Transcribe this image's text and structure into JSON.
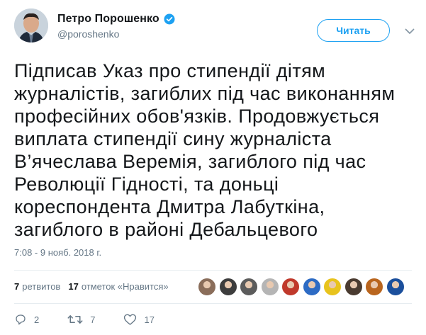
{
  "author": {
    "name": "Петро Порошенко",
    "handle": "@poroshenko"
  },
  "follow_button": {
    "label": "Читать"
  },
  "tweet": {
    "text": "Підписав Указ про стипендії дітям\nжурналістів, загиблих під час виконанням\nпрофесійних обов'язків. Продовжується\nвиплата стипендії сину журналіста\nВ’ячеслава Веремія, загиблого під час\nРеволюції Гідності, та доньці\nкореспондента Дмитра Лабуткіна,\nзагиблого в районі Дебальцевого",
    "timestamp": "7:08 - 9 нояб. 2018 г."
  },
  "stats": {
    "retweets_count": "7",
    "retweets_label": "ретвитов",
    "likes_count": "17",
    "likes_label": "отметок «Нравится»"
  },
  "liker_avatars": [
    {
      "icon": "avatar-1",
      "color": "#8a6d5a"
    },
    {
      "icon": "avatar-2",
      "color": "#3d3d3d"
    },
    {
      "icon": "avatar-3",
      "color": "#5c5c5c"
    },
    {
      "icon": "avatar-4",
      "color": "#b5b5b5"
    },
    {
      "icon": "avatar-5",
      "color": "#c0392b"
    },
    {
      "icon": "avatar-6",
      "color": "#2d6bc4"
    },
    {
      "icon": "avatar-7",
      "color": "#e8c31d"
    },
    {
      "icon": "avatar-8",
      "color": "#4a3b30"
    },
    {
      "icon": "avatar-9",
      "color": "#b9651e"
    },
    {
      "icon": "avatar-10",
      "color": "#1b4f9c"
    }
  ],
  "actions": {
    "reply_count": "2",
    "retweet_count": "7",
    "like_count": "17"
  },
  "colors": {
    "accent": "#1da1f2",
    "text": "#14171a",
    "muted": "#657786",
    "divider": "#e6ecf0"
  }
}
